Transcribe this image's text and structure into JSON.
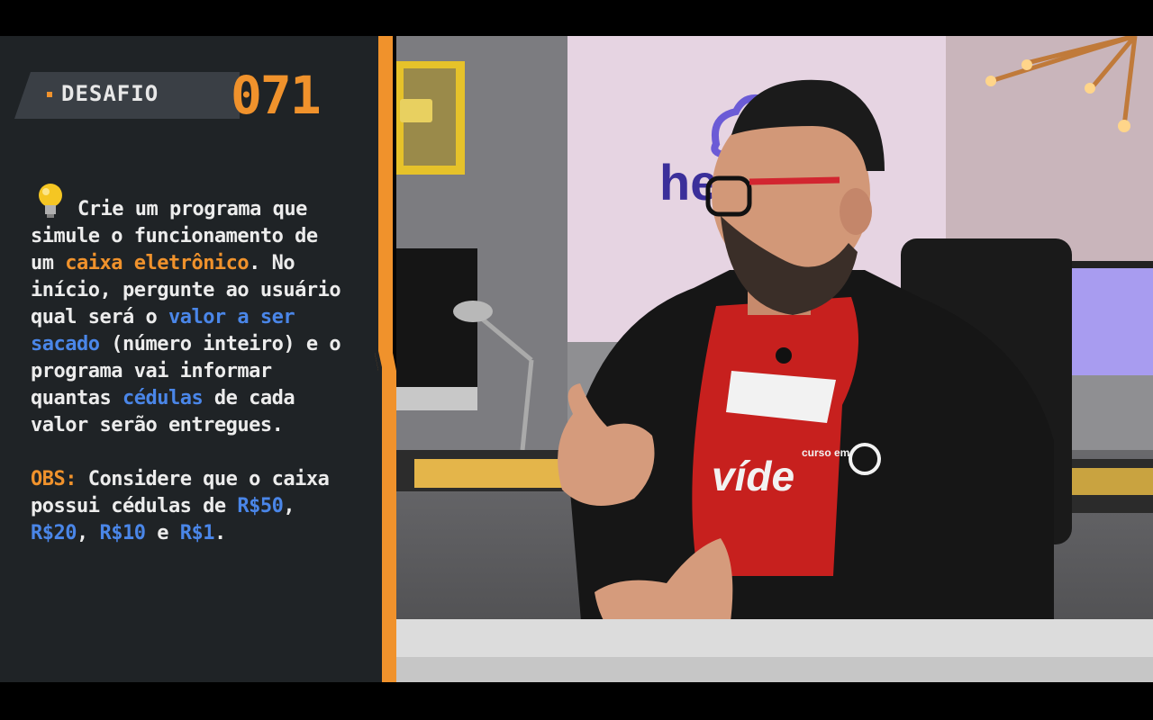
{
  "badge": {
    "label": "DESAFIO",
    "number": "071"
  },
  "challenge": {
    "intro": "Crie um programa que simule o funcionamento de um ",
    "highlight_atm": "caixa eletrônico",
    "after_atm": ".  No início, pergunte ao usuário qual será o ",
    "highlight_value": "valor a ser sacado",
    "after_value": " (número inteiro) e o programa vai informar quantas ",
    "highlight_notes": "cédulas",
    "after_notes": " de cada valor serão entregues."
  },
  "obs": {
    "label": "OBS:",
    "text": " Considere que o caixa possui cédulas de ",
    "note_50": "R$50",
    "sep1": ", ",
    "note_20": "R$20",
    "sep2": ", ",
    "note_10": "R$10",
    "and": " e ",
    "note_1": "R$1",
    "end": "."
  },
  "scene": {
    "wall_logo_fragment": "he",
    "shirt_small_text": "curso em",
    "shirt_big_text": "víde"
  },
  "colors": {
    "accent_orange": "#f0922c",
    "accent_blue": "#4a86e8",
    "panel_bg": "#1f2326"
  }
}
